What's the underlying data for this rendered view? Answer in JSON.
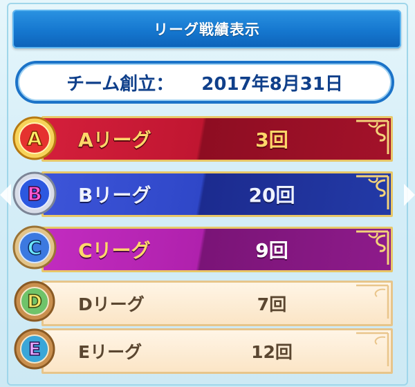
{
  "header": {
    "title": "リーグ戦績表示"
  },
  "founded": {
    "label": "チーム創立：",
    "date": "2017年8月31日"
  },
  "leagues": [
    {
      "letter": "A",
      "name": "Aリーグ",
      "count": "3回",
      "color": "#c01631"
    },
    {
      "letter": "B",
      "name": "Bリーグ",
      "count": "20回",
      "color": "#2f47c8"
    },
    {
      "letter": "C",
      "name": "Cリーグ",
      "count": "9回",
      "color": "#b021ad"
    },
    {
      "letter": "D",
      "name": "Dリーグ",
      "count": "7回",
      "color": "#fbe5c6"
    },
    {
      "letter": "E",
      "name": "Eリーグ",
      "count": "12回",
      "color": "#fbe5c6"
    }
  ]
}
